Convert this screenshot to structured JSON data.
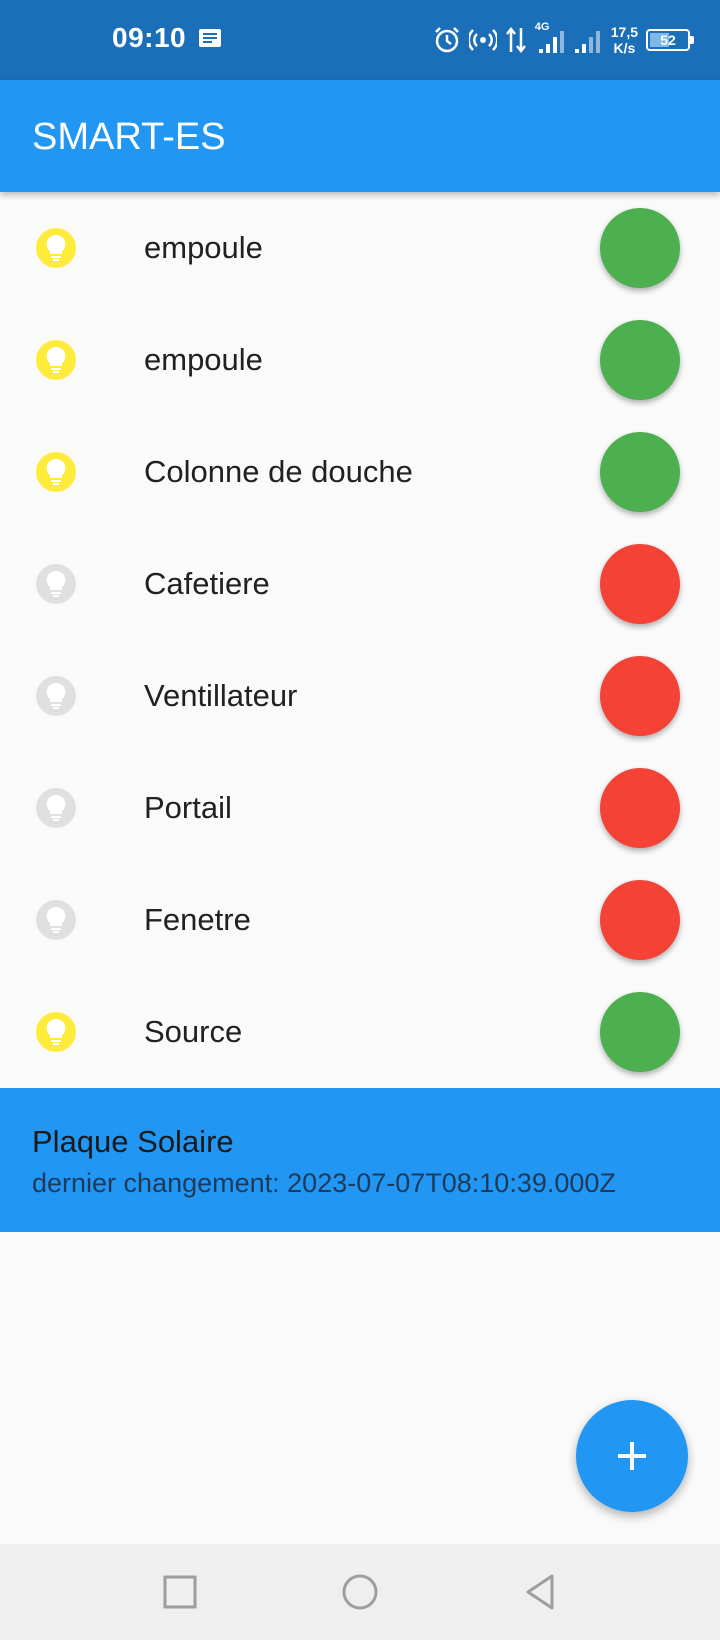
{
  "status_bar": {
    "time": "09:10",
    "network_type": "4G",
    "net_speed_value": "17,5",
    "net_speed_unit": "K/s",
    "battery_level": "52",
    "battery_fraction": 0.52,
    "icons": [
      "message-icon",
      "alarm-icon",
      "hotspot-icon",
      "data-transfer-icon",
      "signal-icon",
      "signal-icon",
      "battery-icon"
    ]
  },
  "app_bar": {
    "title": "SMART-ES"
  },
  "devices": [
    {
      "name": "empoule",
      "state": "on"
    },
    {
      "name": "empoule",
      "state": "on"
    },
    {
      "name": "Colonne de douche",
      "state": "on"
    },
    {
      "name": "Cafetiere",
      "state": "off"
    },
    {
      "name": "Ventillateur",
      "state": "off"
    },
    {
      "name": "Portail",
      "state": "off"
    },
    {
      "name": "Fenetre",
      "state": "off"
    },
    {
      "name": "Source",
      "state": "on"
    }
  ],
  "solar_panel": {
    "title": "Plaque Solaire",
    "last_change": "dernier changement: 2023-07-07T08:10:39.000Z"
  },
  "fab": {
    "icon": "plus-icon"
  },
  "nav_bar": {
    "icons": [
      "recents-square-icon",
      "home-circle-icon",
      "back-triangle-icon"
    ]
  },
  "colors": {
    "status_bar": "#1a6fb8",
    "primary": "#2196f3",
    "bulb_on": "#ffeb3b",
    "bulb_off": "#e0e0e0",
    "toggle_on": "#4caf50",
    "toggle_off": "#f44336"
  }
}
